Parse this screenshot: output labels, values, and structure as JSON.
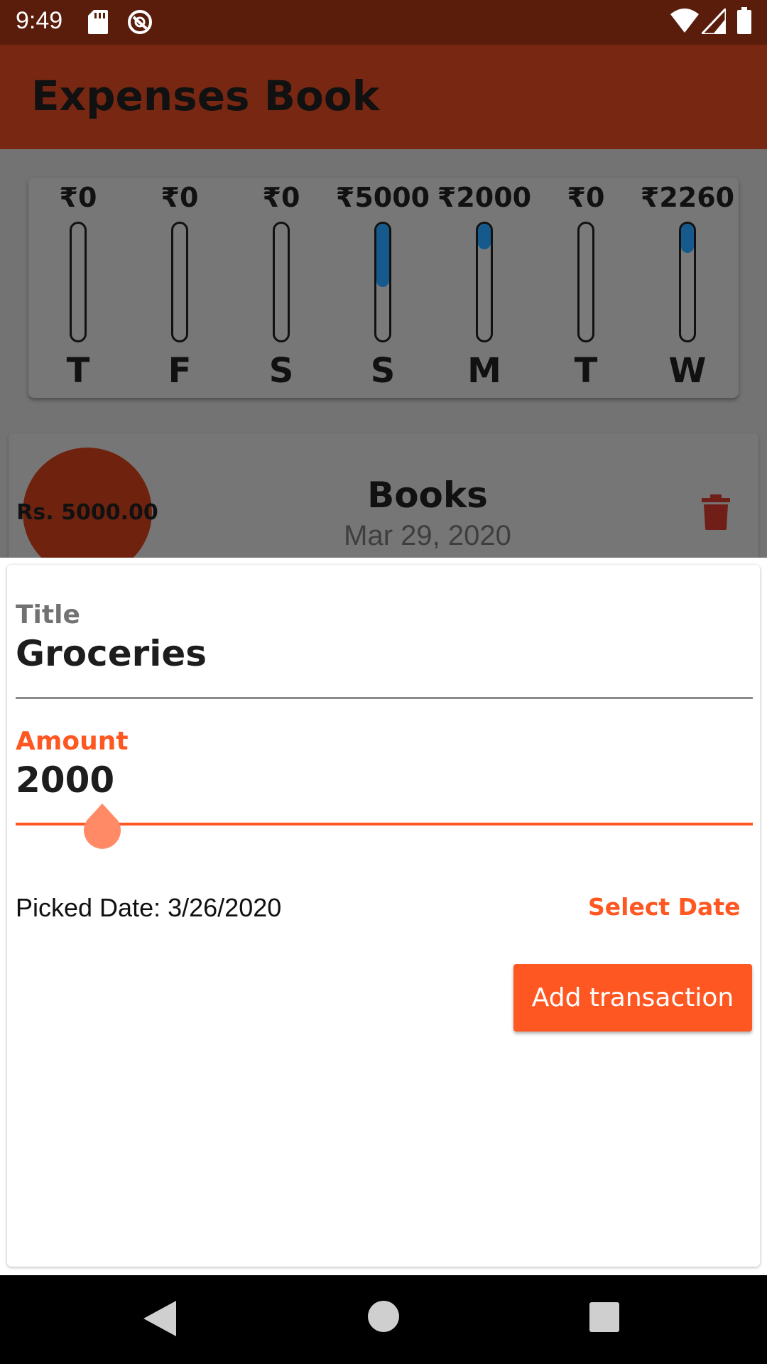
{
  "status_bar": {
    "time": "9:49",
    "icons": [
      "sd-card-icon",
      "sync-ring-icon",
      "wifi-icon",
      "signal-icon",
      "battery-icon"
    ]
  },
  "app_bar": {
    "title": "Expenses Book",
    "color": "#782812"
  },
  "chart": {
    "bars": [
      {
        "day": "T",
        "amount": "₹0",
        "fraction": 0
      },
      {
        "day": "F",
        "amount": "₹0",
        "fraction": 0
      },
      {
        "day": "S",
        "amount": "₹0",
        "fraction": 0
      },
      {
        "day": "S",
        "amount": "₹5000",
        "fraction": 0.54
      },
      {
        "day": "M",
        "amount": "₹2000",
        "fraction": 0.22
      },
      {
        "day": "T",
        "amount": "₹0",
        "fraction": 0
      },
      {
        "day": "W",
        "amount": "₹2260",
        "fraction": 0.25
      }
    ],
    "fill_color": "#165a8d"
  },
  "transaction": {
    "amount": "Rs. 5000.00",
    "title": "Books",
    "date": "Mar 29, 2020",
    "delete_icon": "trash-icon"
  },
  "form": {
    "title_label": "Title",
    "title_value": "Groceries",
    "amount_label": "Amount",
    "amount_value": "2000",
    "picked_date": "Picked Date: 3/26/2020",
    "select_date_label": "Select Date",
    "submit_label": "Add transaction",
    "accent_color": "#ff5722"
  },
  "nav_bar": {
    "icons": [
      "back-icon",
      "home-icon",
      "recents-icon"
    ]
  }
}
